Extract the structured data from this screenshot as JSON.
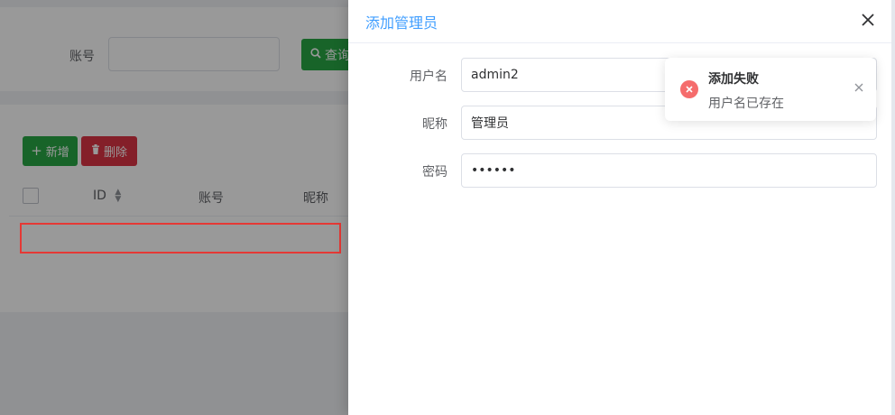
{
  "search": {
    "account_label": "账号",
    "account_value": "",
    "query_button": "查询"
  },
  "toolbar": {
    "add_label": "新增",
    "delete_label": "删除"
  },
  "table": {
    "columns": [
      "ID",
      "账号",
      "昵称"
    ]
  },
  "drawer": {
    "title": "添加管理员",
    "fields": {
      "username_label": "用户名",
      "username_value": "admin2",
      "nickname_label": "昵称",
      "nickname_value": "管理员",
      "password_label": "密码",
      "password_value": "••••••"
    }
  },
  "notification": {
    "title": "添加失败",
    "message": "用户名已存在",
    "color": "#f56c6c"
  },
  "colors": {
    "primary": "#409eff",
    "success": "#28a745",
    "danger": "#dc3545",
    "highlight": "#e53935"
  },
  "icons": {
    "close": "close-icon",
    "search": "search-icon",
    "plus": "plus-icon",
    "trash": "trash-icon",
    "error": "error-circle-icon"
  }
}
